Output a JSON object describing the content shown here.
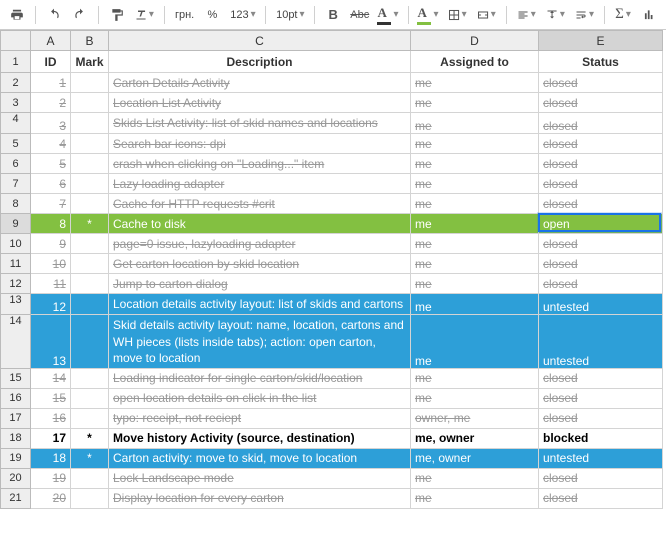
{
  "toolbar": {
    "currency": "грн.",
    "percent": "%",
    "numfmt": "123",
    "fontsize": "10pt",
    "bold": "B",
    "strike": "Abc",
    "font_color": "A",
    "fill_color": "A"
  },
  "columns": {
    "A": "A",
    "B": "B",
    "C": "C",
    "D": "D",
    "E": "E"
  },
  "headers": {
    "id": "ID",
    "mark": "Mark",
    "desc": "Description",
    "assn": "Assigned to",
    "stat": "Status"
  },
  "rows": [
    {
      "n": 2,
      "id": "1",
      "mark": "",
      "desc": "Carton Details Activity",
      "assn": "me",
      "stat": "closed",
      "cls": "closed"
    },
    {
      "n": 3,
      "id": "2",
      "mark": "",
      "desc": "Location List Activity",
      "assn": "me",
      "stat": "closed",
      "cls": "closed"
    },
    {
      "n": 4,
      "id": "3",
      "mark": "",
      "desc": "Skids List Activity: list of skid names and locations",
      "assn": "me",
      "stat": "closed",
      "cls": "closed",
      "wrap": true
    },
    {
      "n": 5,
      "id": "4",
      "mark": "",
      "desc": "Search bar icons: dpi",
      "assn": "me",
      "stat": "closed",
      "cls": "closed"
    },
    {
      "n": 6,
      "id": "5",
      "mark": "",
      "desc": "crash when clicking on \"Loading...\" item",
      "assn": "me",
      "stat": "closed",
      "cls": "closed"
    },
    {
      "n": 7,
      "id": "6",
      "mark": "",
      "desc": "Lazy loading adapter",
      "assn": "me",
      "stat": "closed",
      "cls": "closed"
    },
    {
      "n": 8,
      "id": "7",
      "mark": "",
      "desc": "Cache for HTTP requests #crit",
      "assn": "me",
      "stat": "closed",
      "cls": "closed"
    },
    {
      "n": 9,
      "id": "8",
      "mark": "*",
      "desc": "Cache to disk",
      "assn": "me",
      "stat": "open",
      "cls": "open"
    },
    {
      "n": 10,
      "id": "9",
      "mark": "",
      "desc": "page=0 issue, lazyloading adapter",
      "assn": "me",
      "stat": "closed",
      "cls": "closed"
    },
    {
      "n": 11,
      "id": "10",
      "mark": "",
      "desc": "Get carton location by skid location",
      "assn": "me",
      "stat": "closed",
      "cls": "closed"
    },
    {
      "n": 12,
      "id": "11",
      "mark": "",
      "desc": "Jump to carton dialog",
      "assn": "me",
      "stat": "closed",
      "cls": "closed"
    },
    {
      "n": 13,
      "id": "12",
      "mark": "",
      "desc": "Location details activity layout: list of skids and cartons",
      "assn": "me",
      "stat": "untested",
      "cls": "untested",
      "wrap": true
    },
    {
      "n": 14,
      "id": "13",
      "mark": "",
      "desc": "Skid details activity layout: name, location, cartons and WH pieces (lists inside tabs); action: open carton, move to location",
      "assn": "me",
      "stat": "untested",
      "cls": "untested",
      "wrap": true
    },
    {
      "n": 15,
      "id": "14",
      "mark": "",
      "desc": "Loading indicator for single carton/skid/location",
      "assn": "me",
      "stat": "closed",
      "cls": "closed"
    },
    {
      "n": 16,
      "id": "15",
      "mark": "",
      "desc": "open location details on click in the list",
      "assn": "me",
      "stat": "closed",
      "cls": "closed"
    },
    {
      "n": 17,
      "id": "16",
      "mark": "",
      "desc": "typo: receipt, not reciept",
      "assn": "owner, me",
      "stat": "closed",
      "cls": "closed"
    },
    {
      "n": 18,
      "id": "17",
      "mark": "*",
      "desc": "Move history Activity (source, destination)",
      "assn": "me, owner",
      "stat": "blocked",
      "cls": "blocked"
    },
    {
      "n": 19,
      "id": "18",
      "mark": "*",
      "desc": "Carton activity: move to skid, move to location",
      "assn": "me, owner",
      "stat": "untested",
      "cls": "untested"
    },
    {
      "n": 20,
      "id": "19",
      "mark": "",
      "desc": "Lock Landscape mode",
      "assn": "me",
      "stat": "closed",
      "cls": "closed"
    },
    {
      "n": 21,
      "id": "20",
      "mark": "",
      "desc": "Display location for every carton",
      "assn": "me",
      "stat": "closed",
      "cls": "closed"
    }
  ],
  "chart_data": {
    "type": "table",
    "title": "",
    "columns": [
      "ID",
      "Mark",
      "Description",
      "Assigned to",
      "Status"
    ],
    "rows": [
      [
        1,
        "",
        "Carton Details Activity",
        "me",
        "closed"
      ],
      [
        2,
        "",
        "Location List Activity",
        "me",
        "closed"
      ],
      [
        3,
        "",
        "Skids List Activity: list of skid names and locations",
        "me",
        "closed"
      ],
      [
        4,
        "",
        "Search bar icons: dpi",
        "me",
        "closed"
      ],
      [
        5,
        "",
        "crash when clicking on \"Loading...\" item",
        "me",
        "closed"
      ],
      [
        6,
        "",
        "Lazy loading adapter",
        "me",
        "closed"
      ],
      [
        7,
        "",
        "Cache for HTTP requests #crit",
        "me",
        "closed"
      ],
      [
        8,
        "*",
        "Cache to disk",
        "me",
        "open"
      ],
      [
        9,
        "",
        "page=0 issue, lazyloading adapter",
        "me",
        "closed"
      ],
      [
        10,
        "",
        "Get carton location by skid location",
        "me",
        "closed"
      ],
      [
        11,
        "",
        "Jump to carton dialog",
        "me",
        "closed"
      ],
      [
        12,
        "",
        "Location details activity layout: list of skids and cartons",
        "me",
        "untested"
      ],
      [
        13,
        "",
        "Skid details activity layout: name, location, cartons and WH pieces (lists inside tabs); action: open carton, move to location",
        "me",
        "untested"
      ],
      [
        14,
        "",
        "Loading indicator for single carton/skid/location",
        "me",
        "closed"
      ],
      [
        15,
        "",
        "open location details on click in the list",
        "me",
        "closed"
      ],
      [
        16,
        "",
        "typo: receipt, not reciept",
        "owner, me",
        "closed"
      ],
      [
        17,
        "*",
        "Move history Activity (source, destination)",
        "me, owner",
        "blocked"
      ],
      [
        18,
        "*",
        "Carton activity: move to skid, move to location",
        "me, owner",
        "untested"
      ],
      [
        19,
        "",
        "Lock Landscape mode",
        "me",
        "closed"
      ],
      [
        20,
        "",
        "Display location for every carton",
        "me",
        "closed"
      ]
    ]
  }
}
